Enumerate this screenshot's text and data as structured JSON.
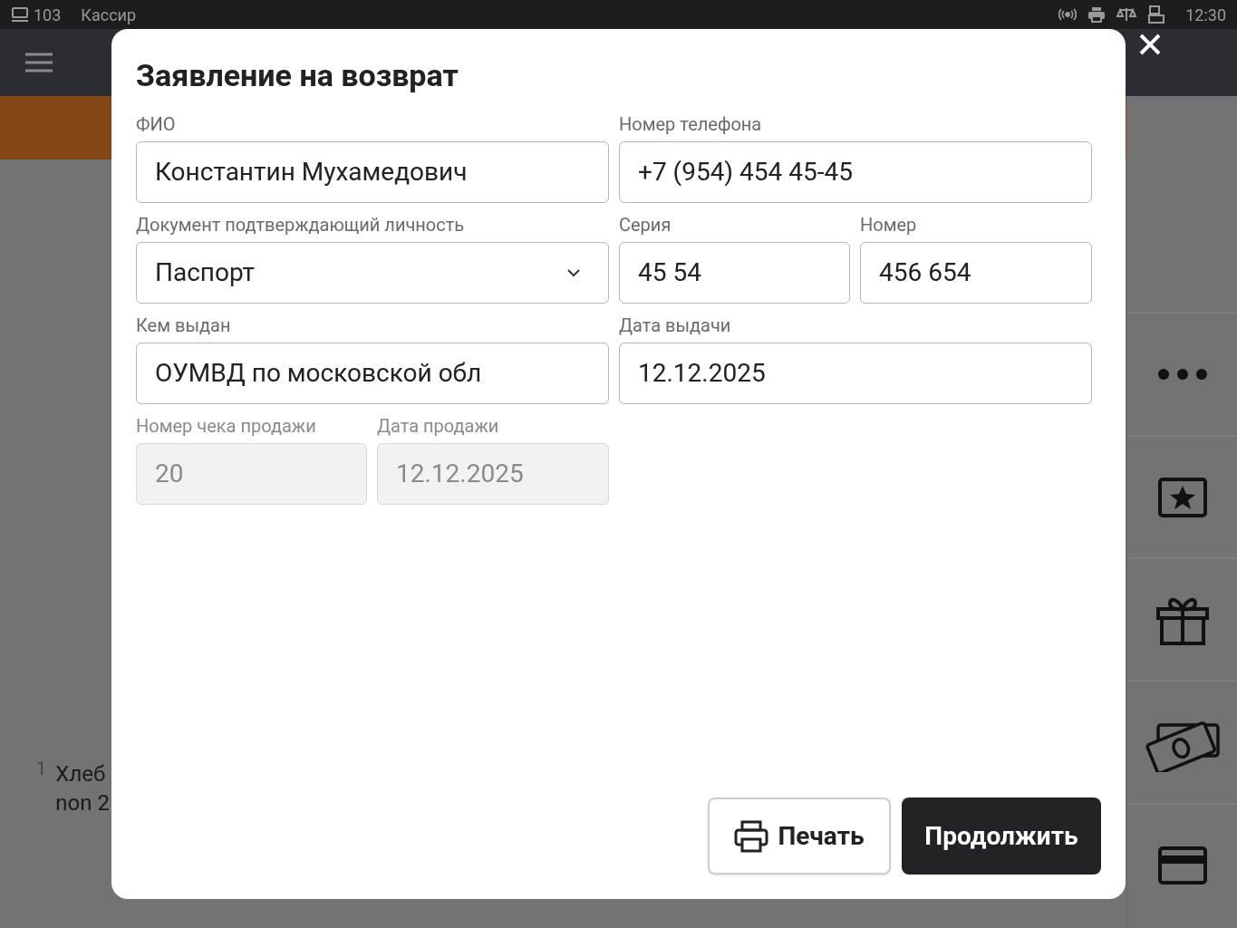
{
  "status_bar": {
    "terminal": "103",
    "role": "Кассир",
    "time": "12:30"
  },
  "background": {
    "receipt_items": [
      {
        "index": "1",
        "name": "Хлеб",
        "detail": "non 2"
      }
    ]
  },
  "dialog": {
    "title": "Заявление на возврат",
    "fields": [
      {
        "label": "ФИО",
        "value": "Константин Мухамедович",
        "kind": "text",
        "disabled": false
      },
      {
        "label": "Номер телефона",
        "value": "+7 (954) 454 45-45",
        "kind": "text",
        "disabled": false
      },
      {
        "label": "Документ подтверждающий личность",
        "value": "Паспорт",
        "kind": "select",
        "disabled": false
      },
      {
        "label": "Серия",
        "value": "45 54",
        "kind": "text",
        "disabled": false
      },
      {
        "label": "Номер",
        "value": "456 654",
        "kind": "text",
        "disabled": false
      },
      {
        "label": "Кем выдан",
        "value": "ОУМВД по московской обл",
        "kind": "text",
        "disabled": false
      },
      {
        "label": "Дата выдачи",
        "value": "12.12.2025",
        "kind": "text",
        "disabled": false
      },
      {
        "label": "Номер чека продажи",
        "value": "20",
        "kind": "text",
        "disabled": true
      },
      {
        "label": "Дата продажи",
        "value": "12.12.2025",
        "kind": "text",
        "disabled": true
      }
    ],
    "buttons": [
      {
        "label": "Печать",
        "kind": "secondary"
      },
      {
        "label": "Продолжить",
        "kind": "primary"
      }
    ]
  }
}
